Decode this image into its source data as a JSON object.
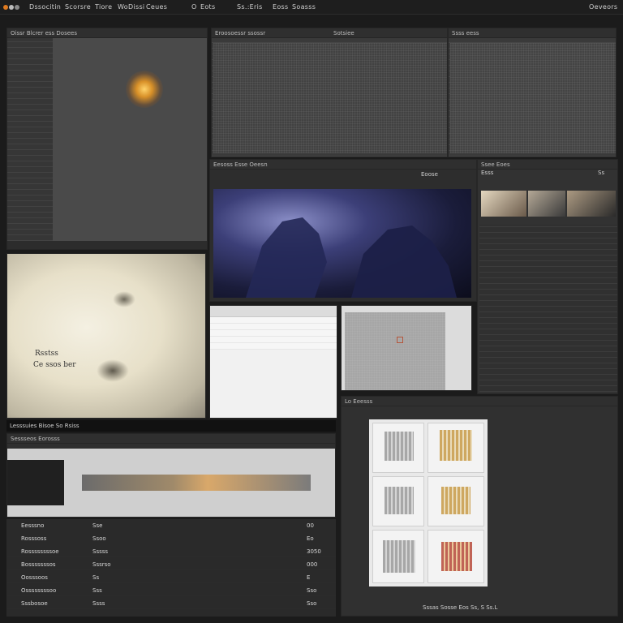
{
  "menubar": {
    "items": [
      "Dssocitin",
      "Scorsre",
      "Tiore",
      "Wo",
      "Dissi",
      "Ceues",
      "O",
      "Eots",
      "Ss.:Eris",
      "Eoss",
      "Soasss",
      "Oeveors"
    ]
  },
  "left_viewer": {
    "header": "Oissr Blcrer ess Dosees"
  },
  "top_center": {
    "header": "Eroosoessr ssossr",
    "tab": "Sotsiee"
  },
  "top_right": {
    "header": "Ssss eess"
  },
  "center_viewer": {
    "header": "Eesoss Esse Oeesn",
    "tab": "Eoose"
  },
  "right_panel": {
    "header": "Ssee Eoes",
    "tab": "Esss",
    "button": "Ss"
  },
  "beige_viewer": {
    "overlay_line1": "Rsstss",
    "overlay_line2": "Ce ssos ber"
  },
  "beige_caption": "Lesssuies Bisoe  So  Rsiss",
  "timeline_panel": {
    "header": "Sessseos  Eorosss"
  },
  "table": {
    "rows": [
      {
        "col1": "Eesssno",
        "col2": "Sse",
        "col3": "00"
      },
      {
        "col1": "Rosssoss",
        "col2": "Ssoo",
        "col3": "Eo"
      },
      {
        "col1": "Rossssssssoe",
        "col2": "Sssss",
        "col3": "3050"
      },
      {
        "col1": "Bosssssssos",
        "col2": "Sssrso",
        "col3": "000"
      },
      {
        "col1": "Oosssoos",
        "col2": "Ss",
        "col3": "E"
      },
      {
        "col1": "Ossssssssoo",
        "col2": "Sss",
        "col3": "Sso"
      },
      {
        "col1": "Sssbosoe",
        "col2": "Ssss",
        "col3": "Sso"
      }
    ]
  },
  "bottom_right": {
    "header": "Lo Eeesss",
    "status": "Sssas  Sosse  Eos  Ss, S  Ss.L"
  }
}
